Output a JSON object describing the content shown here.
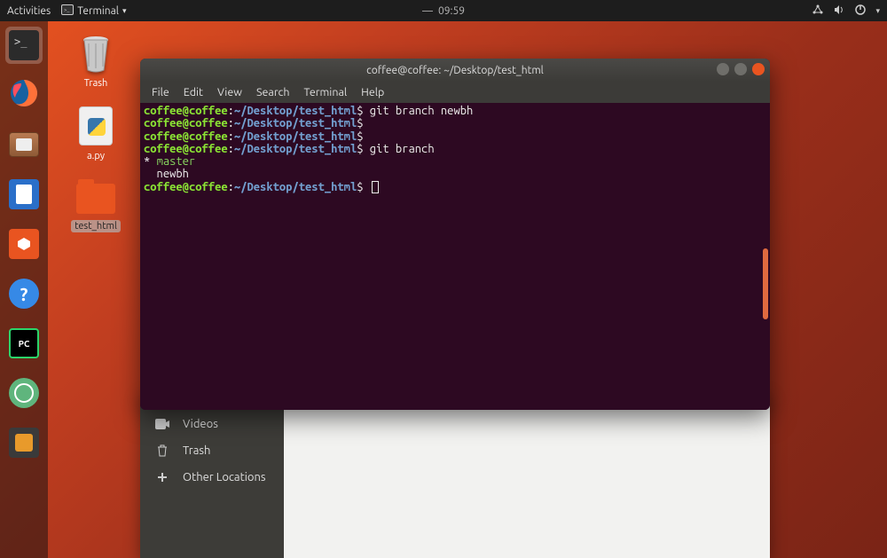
{
  "topbar": {
    "activities": "Activities",
    "app_name": "Terminal",
    "clock_separator": "—",
    "clock": "09:59"
  },
  "desktop": {
    "trash": {
      "label": "Trash"
    },
    "apy": {
      "label": "a.py"
    },
    "test_html": {
      "label": "test_html"
    }
  },
  "files_window": {
    "sidebar": {
      "videos": "Videos",
      "trash": "Trash",
      "other": "Other Locations"
    }
  },
  "terminal": {
    "title": "coffee@coffee: ~/Desktop/test_html",
    "menu": {
      "file": "File",
      "edit": "Edit",
      "view": "View",
      "search": "Search",
      "terminal": "Terminal",
      "help": "Help"
    },
    "prompt": {
      "userhost": "coffee@coffee",
      "colon": ":",
      "path": "~/Desktop/test_html",
      "dollar": "$"
    },
    "lines": {
      "cmd1": " git branch newbh",
      "cmd2": "",
      "cmd3": "",
      "cmd4": " git branch",
      "out_master_star": "* ",
      "out_master": "master",
      "out_newbh": "  newbh",
      "cursor_cmd": " "
    }
  }
}
